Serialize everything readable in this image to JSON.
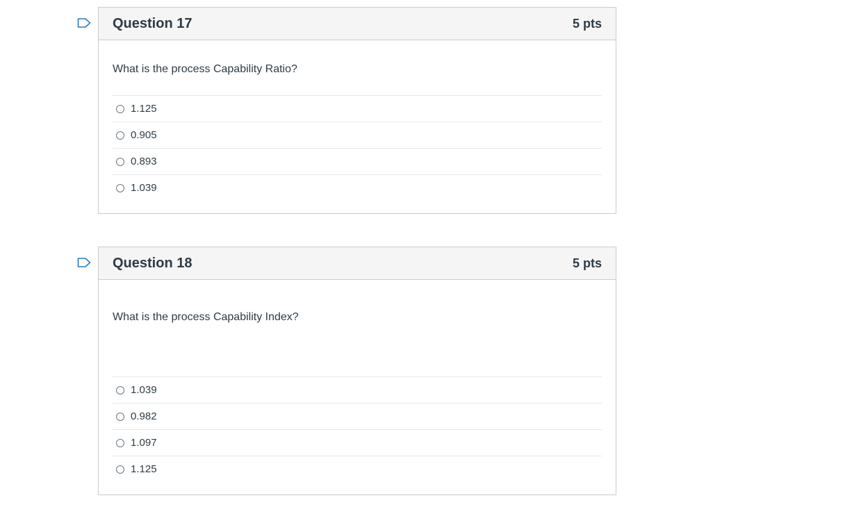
{
  "questions": [
    {
      "title": "Question 17",
      "points": "5 pts",
      "text": "What is the process Capability Ratio?",
      "options": [
        "1.125",
        "0.905",
        "0.893",
        "1.039"
      ]
    },
    {
      "title": "Question 18",
      "points": "5 pts",
      "text": "What is the process Capability Index?",
      "options": [
        "1.039",
        "0.982",
        "1.097",
        "1.125"
      ]
    }
  ],
  "icons": {
    "flag": "bookmark-flag-icon",
    "radio": "radio-unselected"
  },
  "colors": {
    "flag_stroke": "#2b7abc",
    "header_bg": "#f5f5f5",
    "border": "#c7cdd1"
  }
}
